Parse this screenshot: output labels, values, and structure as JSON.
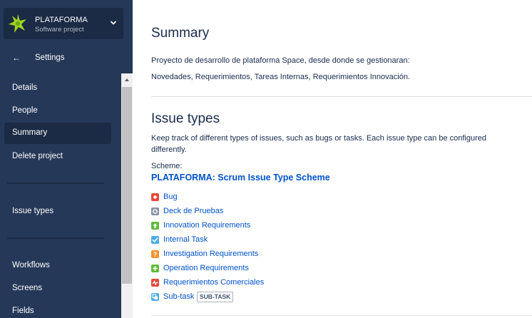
{
  "project": {
    "name": "PLATAFORMA",
    "type": "Software project"
  },
  "nav": {
    "back_label": "Settings",
    "items": [
      {
        "label": "Details"
      },
      {
        "label": "People"
      },
      {
        "label": "Summary"
      },
      {
        "label": "Delete project"
      },
      {
        "label": "Issue types"
      },
      {
        "label": "Workflows"
      },
      {
        "label": "Screens"
      },
      {
        "label": "Fields"
      }
    ],
    "active": "Summary"
  },
  "summary": {
    "title": "Summary",
    "description_line1": "Proyecto de desarrollo de plataforma Space, desde donde se gestionaran:",
    "description_line2": "Novedades, Requerimientos, Tareas Internas, Requerimientos Innovación."
  },
  "issue_types": {
    "title": "Issue types",
    "description": "Keep track of different types of issues, such as bugs or tasks. Each issue type can be configured differently.",
    "scheme_label": "Scheme:",
    "scheme_name": "PLATAFORMA: Scrum Issue Type Scheme",
    "types": [
      {
        "name": "Bug",
        "icon": "bug-icon",
        "color": "#e5493a"
      },
      {
        "name": "Deck de Pruebas",
        "icon": "gear-icon",
        "color": "#8993a4"
      },
      {
        "name": "Innovation Requirements",
        "icon": "arrow-up-icon",
        "color": "#63ba3c"
      },
      {
        "name": "Internal Task",
        "icon": "checkbox-icon",
        "color": "#4bade8"
      },
      {
        "name": "Investigation Requirements",
        "icon": "question-icon",
        "color": "#f79232"
      },
      {
        "name": "Operation Requirements",
        "icon": "plus-icon",
        "color": "#63ba3c"
      },
      {
        "name": "Requerimientos Comerciales",
        "icon": "pulse-icon",
        "color": "#e5493a"
      },
      {
        "name": "Sub-task",
        "icon": "subtask-icon",
        "color": "#4bade8",
        "badge": "SUB-TASK"
      }
    ]
  },
  "colors": {
    "sidebar_bg": "#253858",
    "sidebar_active": "#1b2a45",
    "link": "#0052cc",
    "text": "#172b4d"
  }
}
